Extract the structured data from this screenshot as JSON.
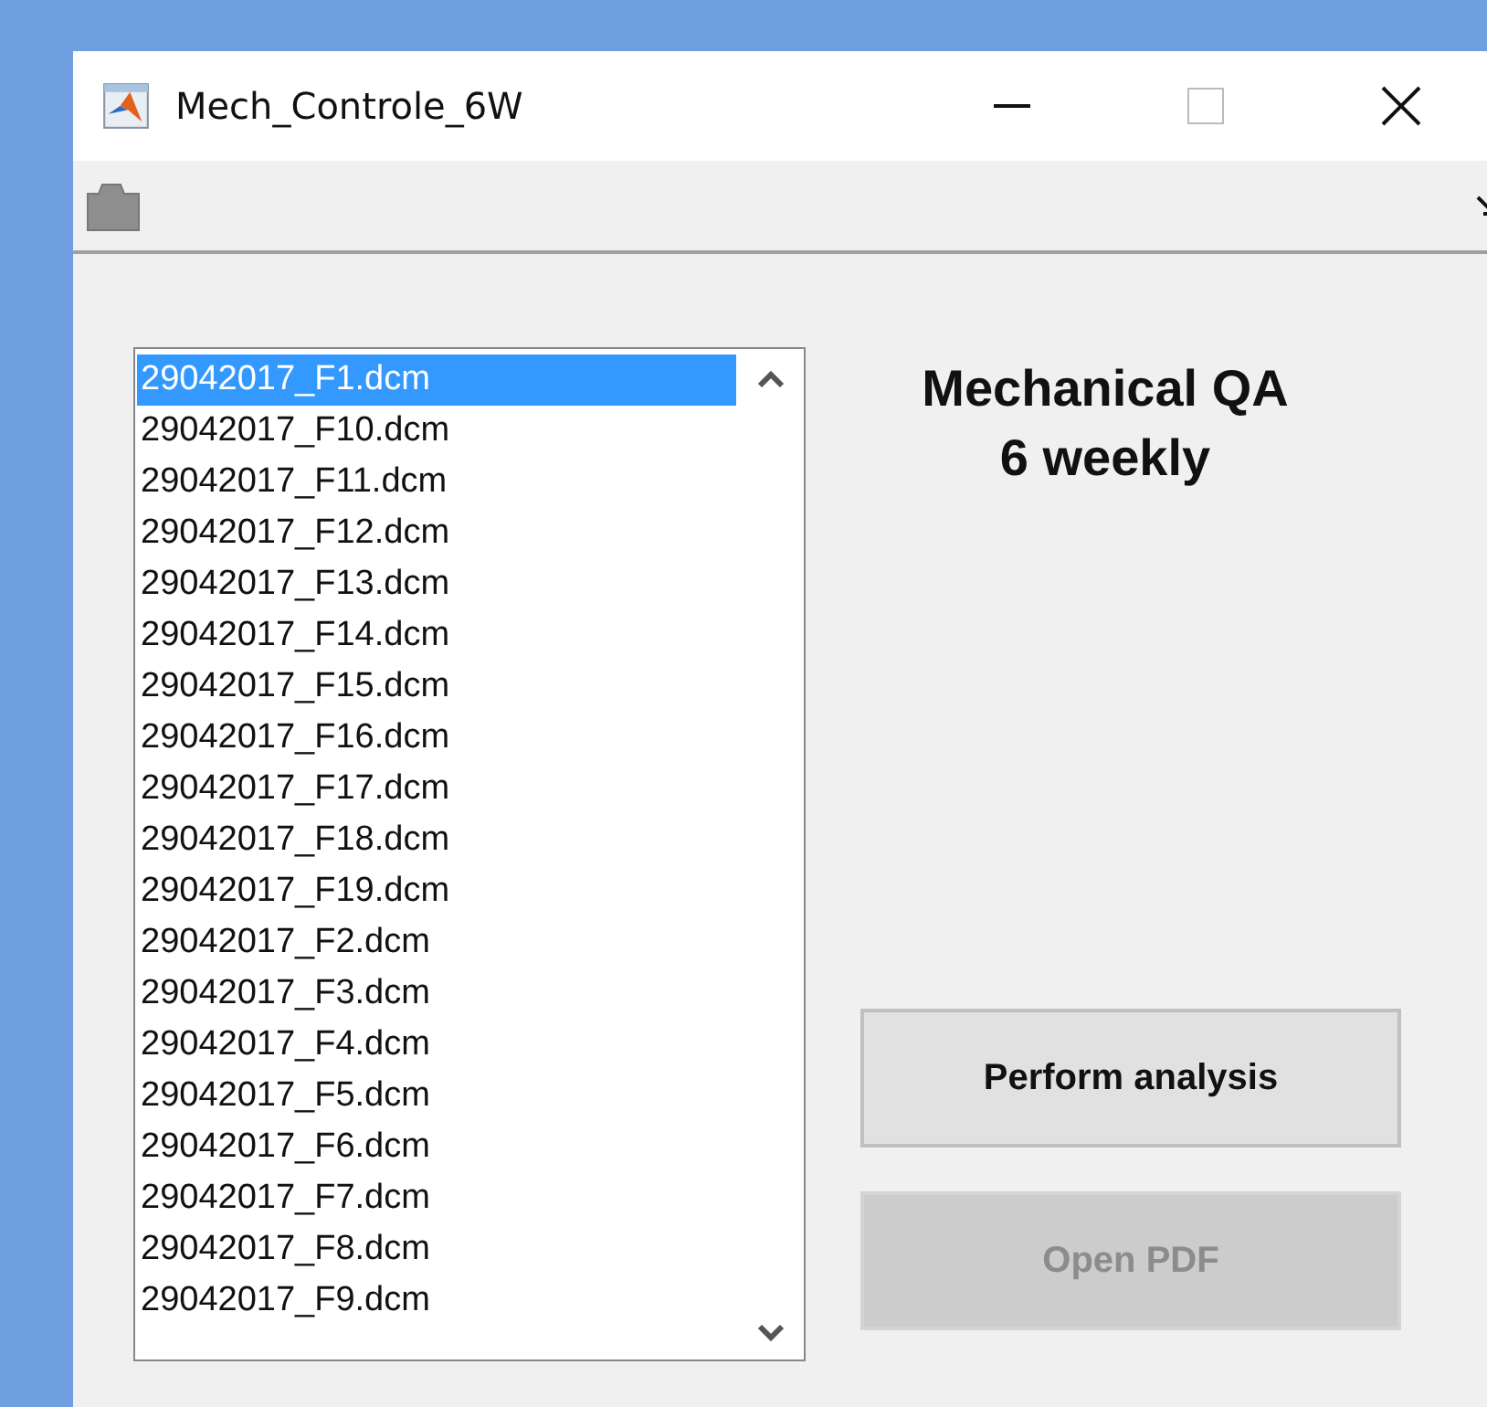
{
  "window": {
    "title": "Mech_Controle_6W"
  },
  "files": [
    {
      "name": "29042017_F1.dcm",
      "selected": true
    },
    {
      "name": "29042017_F10.dcm",
      "selected": false
    },
    {
      "name": "29042017_F11.dcm",
      "selected": false
    },
    {
      "name": "29042017_F12.dcm",
      "selected": false
    },
    {
      "name": "29042017_F13.dcm",
      "selected": false
    },
    {
      "name": "29042017_F14.dcm",
      "selected": false
    },
    {
      "name": "29042017_F15.dcm",
      "selected": false
    },
    {
      "name": "29042017_F16.dcm",
      "selected": false
    },
    {
      "name": "29042017_F17.dcm",
      "selected": false
    },
    {
      "name": "29042017_F18.dcm",
      "selected": false
    },
    {
      "name": "29042017_F19.dcm",
      "selected": false
    },
    {
      "name": "29042017_F2.dcm",
      "selected": false
    },
    {
      "name": "29042017_F3.dcm",
      "selected": false
    },
    {
      "name": "29042017_F4.dcm",
      "selected": false
    },
    {
      "name": "29042017_F5.dcm",
      "selected": false
    },
    {
      "name": "29042017_F6.dcm",
      "selected": false
    },
    {
      "name": "29042017_F7.dcm",
      "selected": false
    },
    {
      "name": "29042017_F8.dcm",
      "selected": false
    },
    {
      "name": "29042017_F9.dcm",
      "selected": false
    }
  ],
  "heading": [
    "Mechanical QA",
    "6 weekly"
  ],
  "buttons": [
    {
      "label": "Perform analysis",
      "disabled": false
    },
    {
      "label": "Open PDF",
      "disabled": true
    }
  ]
}
